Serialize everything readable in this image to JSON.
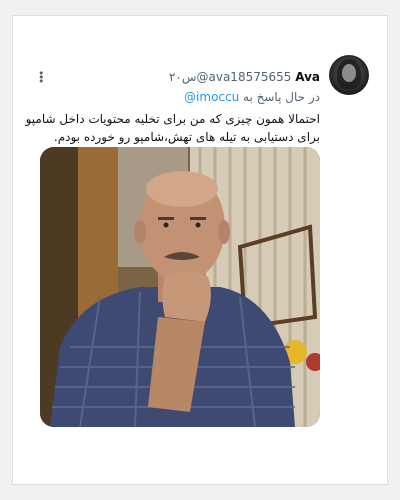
{
  "tweet": {
    "author_name": "Ava",
    "author_handle": "@ava18575655",
    "separator": " · ",
    "time": "۲۰س",
    "reply_prefix": "در حال پاسخ به",
    "reply_handle": "@imoccu",
    "text_lines": [
      "احتمالا همون چیزی که من برای تخلیه محتویات داخل شامپو",
      "برای دستیابی به تیله های تهش،شامپو رو خورده بودم."
    ]
  },
  "icons": {
    "more": "more-vertical-icon",
    "avatar": "avatar-image"
  },
  "colors": {
    "link": "#1d9bf0",
    "secondary_text": "#536471",
    "primary_text": "#0f1419"
  }
}
